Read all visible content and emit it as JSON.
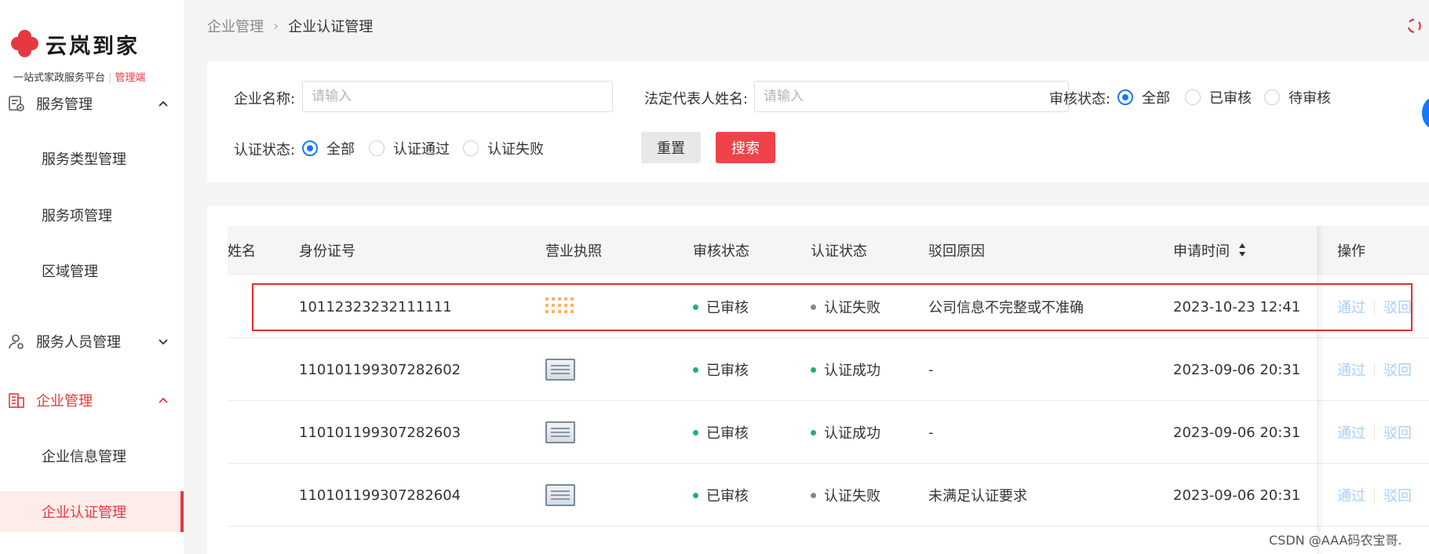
{
  "sidebar": {
    "logo_text": "云岚到家",
    "logo_sub_a": "一站式家政服务平台",
    "logo_sub_b": "管理端",
    "groups": [
      {
        "label": "服务管理",
        "items": [
          "服务类型管理",
          "服务项管理",
          "区域管理"
        ]
      },
      {
        "label": "服务人员管理"
      },
      {
        "label": "企业管理",
        "items": [
          "企业信息管理",
          "企业认证管理"
        ]
      }
    ]
  },
  "breadcrumb": {
    "parent": "企业管理",
    "current": "企业认证管理"
  },
  "filters": {
    "company_name_label": "企业名称:",
    "company_name_placeholder": "请输入",
    "legal_rep_label": "法定代表人姓名:",
    "legal_rep_placeholder": "请输入",
    "audit_status_label": "审核状态:",
    "audit_options": [
      "全部",
      "已审核",
      "待审核"
    ],
    "cert_status_label": "认证状态:",
    "cert_options": [
      "全部",
      "认证通过",
      "认证失败"
    ],
    "reset_label": "重置",
    "search_label": "搜索"
  },
  "table": {
    "columns": {
      "name_partial": "姓名",
      "id_number": "身份证号",
      "license": "营业执照",
      "audit_status": "审核状态",
      "cert_status": "认证状态",
      "reject_reason": "驳回原因",
      "apply_time": "申请时间",
      "actions": "操作"
    },
    "rows": [
      {
        "id_number": "10112323232111111",
        "audit_status": "已审核",
        "cert_status": "认证失败",
        "reject_reason": "公司信息不完整或不准确",
        "apply_time": "2023-10-23 12:41"
      },
      {
        "id_number": "110101199307282602",
        "audit_status": "已审核",
        "cert_status": "认证成功",
        "reject_reason": "-",
        "apply_time": "2023-09-06 20:31"
      },
      {
        "id_number": "110101199307282603",
        "audit_status": "已审核",
        "cert_status": "认证成功",
        "reject_reason": "-",
        "apply_time": "2023-09-06 20:31"
      },
      {
        "id_number": "110101199307282604",
        "audit_status": "已审核",
        "cert_status": "认证失败",
        "reject_reason": "未满足认证要求",
        "apply_time": "2023-09-06 20:31"
      }
    ],
    "action_approve": "通过",
    "action_reject": "驳回"
  },
  "colors": {
    "brand_red": "#e6393f",
    "link_blue_disabled": "#a9cff5",
    "radio_blue": "#1677ff",
    "status_green": "#1fb36b",
    "status_gray": "#888888"
  },
  "watermark": "CSDN @AAA码农宝哥."
}
